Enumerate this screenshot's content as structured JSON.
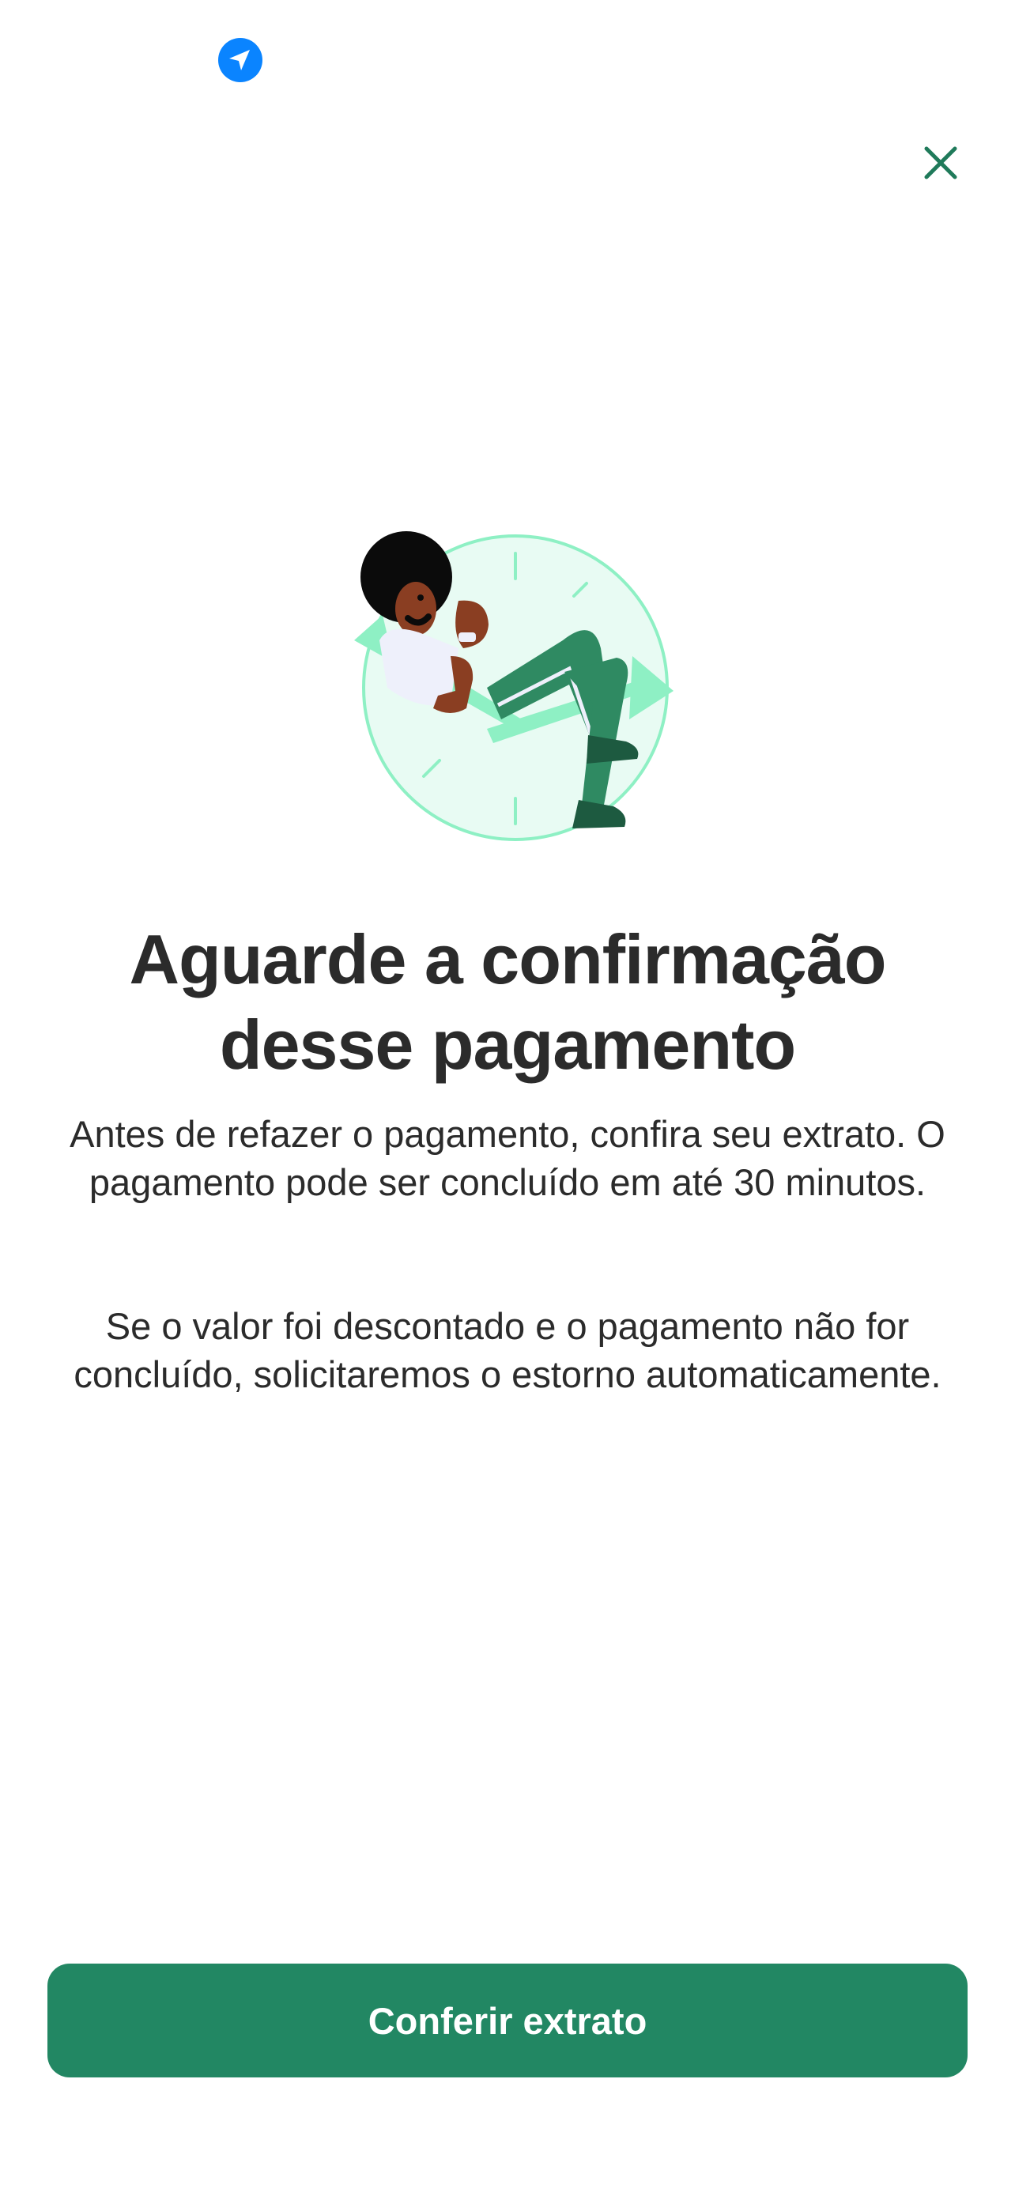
{
  "status_bar": {
    "location_icon": "location-arrow-icon"
  },
  "header": {
    "close_icon": "close-icon"
  },
  "illustration": {
    "name": "person-relaxing-on-clock-illustration"
  },
  "main": {
    "title_line_1": "Aguarde a confirmação",
    "title_line_2": "desse pagamento",
    "paragraph_1": "Antes de refazer o pagamento, confira seu extrato. O pagamento pode ser concluído em até 30 minutos.",
    "paragraph_2": "Se o valor foi descontado e o pagamento não for concluído, solicitaremos o estorno automaticamente."
  },
  "footer": {
    "primary_button_label": "Conferir extrato"
  },
  "colors": {
    "brand_green": "#228763",
    "close_green": "#1f7a5a",
    "location_blue": "#0a84ff",
    "text_dark": "#2b2b2b"
  }
}
